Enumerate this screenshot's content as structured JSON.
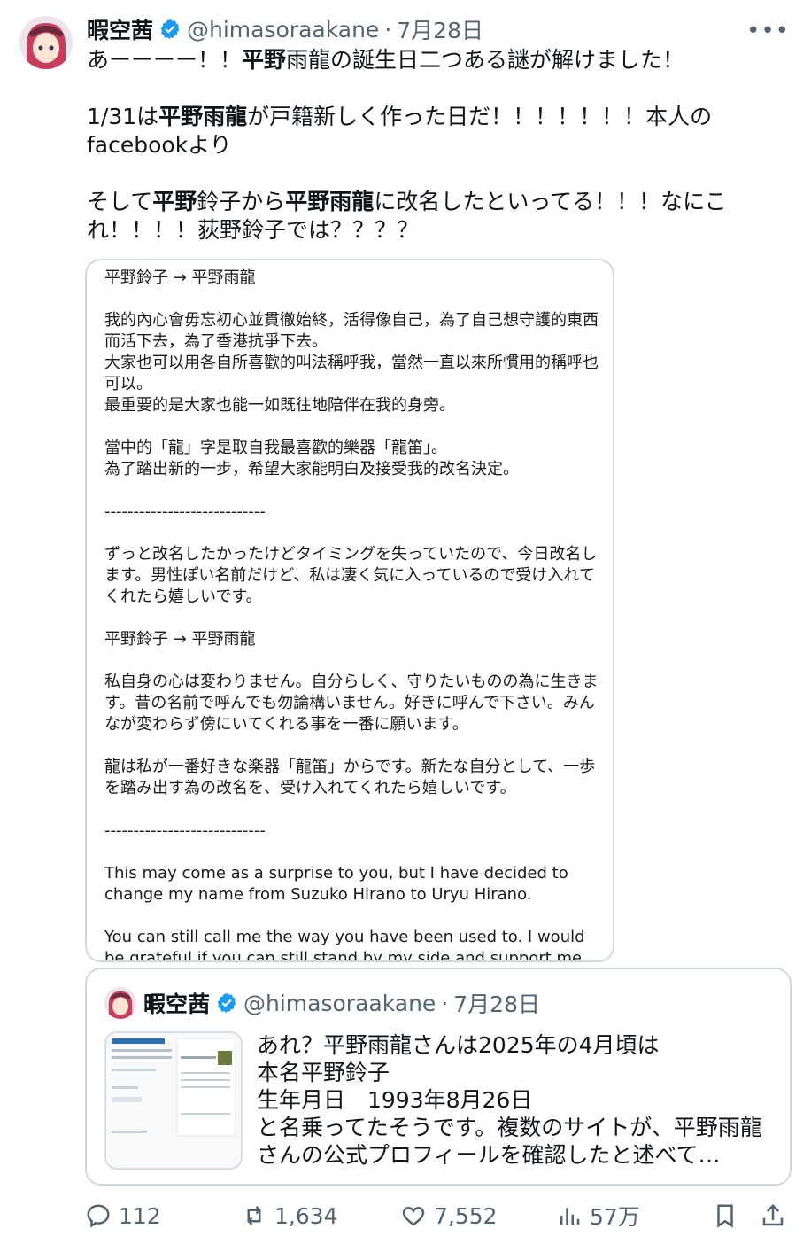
{
  "tweet": {
    "author_name": "暇空茜",
    "handle": "@himasoraakane",
    "separator": "·",
    "date": "7月28日",
    "more_label": "•••",
    "line1": "あーーーー！！",
    "line1_bold": "平野",
    "line1_rest": "雨龍の誕生日二つある謎が解けました！",
    "line2_a": "1/31は",
    "line2_bold": "平野雨龍",
    "line2_b": "が戸籍新しく作った日だ！！！！！！！本人のfacebookより",
    "line3_a": "そして",
    "line3_bold1": "平野",
    "line3_b": "鈴子から",
    "line3_bold2": "平野雨龍",
    "line3_c": "に改名したといってる！！！なにこれ！！！！荻野鈴子では？？？？"
  },
  "image_text": {
    "lines": [
      "平野鈴子 → 平野雨龍",
      "",
      "我的內心會毋忘初心並貫徹始終，活得像自己，為了自己想守護的東西而活下去，為了香港抗爭下去。",
      "大家也可以用各自所喜歡的叫法稱呼我，當然一直以來所慣用的稱呼也可以。",
      "最重要的是大家也能一如既往地陪伴在我的身旁。",
      "",
      "當中的「龍」字是取自我最喜歡的樂器「龍笛」。",
      "為了踏出新的一步，希望大家能明白及接受我的改名決定。",
      "",
      "----------------------------",
      "",
      "ずっと改名したかったけどタイミングを失っていたので、今日改名します。男性ぽい名前だけど、私は凄く気に入っているので受け入れてくれたら嬉しいです。",
      "",
      "平野鈴子 → 平野雨龍",
      "",
      "私自身の心は変わりません。自分らしく、守りたいものの為に生きます。昔の名前で呼んでも勿論構いません。好きに呼んで下さい。みんなが変わらず傍にいてくれる事を一番に願います。",
      "",
      "龍は私が一番好きな楽器「龍笛」からです。新たな自分として、一歩を踏み出す為の改名を、受け入れてくれたら嬉しいです。",
      "",
      "----------------------------",
      "",
      "This may come as a surprise to you, but I have decided to change my name from Suzuko Hirano to Uryu Hirano.",
      "",
      "You can still call me the way you have been used to. I would be grateful if you can still stand by my side and support me"
    ]
  },
  "quote": {
    "author_name": "暇空茜",
    "handle": "@himasoraakane",
    "separator": "·",
    "date": "7月28日",
    "text": "あれ？平野雨龍さんは2025年の4月頃は\n本名平野鈴子\n生年月日　1993年8月26日\nと名乗ってたそうです。複数のサイトが、平野雨龍さんの公式プロフィールを確認したと述べて…"
  },
  "actions": {
    "replies": "112",
    "retweets": "1,634",
    "likes": "7,552",
    "views": "57万"
  },
  "colors": {
    "verified": "#1d9bf0",
    "muted": "#536471",
    "border": "#cfd9de"
  }
}
